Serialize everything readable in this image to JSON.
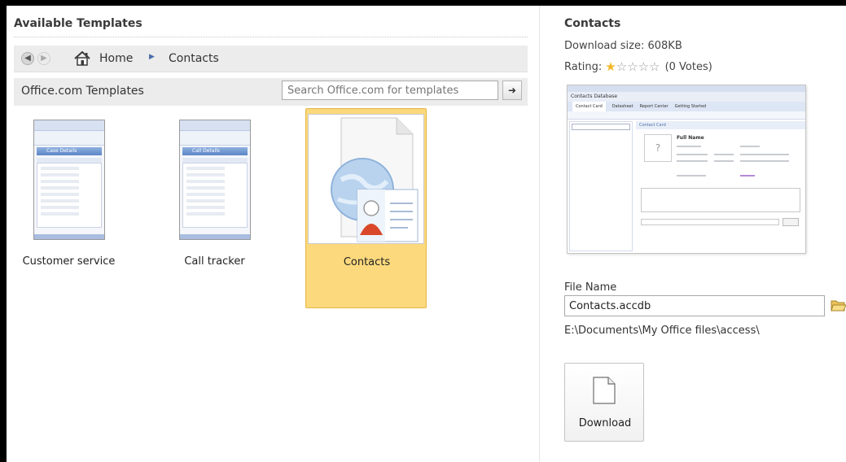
{
  "left": {
    "title": "Available Templates",
    "nav": {
      "home_label": "Home",
      "current_label": "Contacts"
    },
    "office": {
      "label": "Office.com Templates",
      "search_placeholder": "Search Office.com for templates"
    },
    "templates": [
      {
        "label": "Customer service",
        "thumb_header": "Case Details",
        "selected": false
      },
      {
        "label": "Call tracker",
        "thumb_header": "Call Details",
        "selected": false
      },
      {
        "label": "Contacts",
        "selected": true
      }
    ]
  },
  "right": {
    "title": "Contacts",
    "download_size_label": "Download size:",
    "download_size": "608KB",
    "rating_label": "Rating:",
    "rating_stars": 1,
    "rating_max": 5,
    "votes": "(0 Votes)",
    "preview": {
      "db_title": "Contacts Database",
      "tabs": [
        "Contact Card",
        "Datasheet",
        "Report Center",
        "Getting Started"
      ],
      "card_header": "Contact Card",
      "name": "Full Name"
    },
    "file_name_label": "File Name",
    "file_name_value": "Contacts.accdb",
    "save_path": "E:\\Documents\\My Office files\\access\\",
    "download_label": "Download"
  },
  "colors": {
    "selected_bg": "#fcd97d",
    "selected_border": "#e4b546",
    "star_on": "#f1b829",
    "star_off": "#9a9a9a",
    "bar_bg": "#ececec"
  },
  "icons": {
    "back": "arrow-left-icon",
    "forward": "arrow-right-icon",
    "home": "home-icon",
    "breadcrumb_sep": "triangle-right-icon",
    "search_go": "arrow-right-icon",
    "folder": "open-folder-icon",
    "download": "document-icon"
  }
}
